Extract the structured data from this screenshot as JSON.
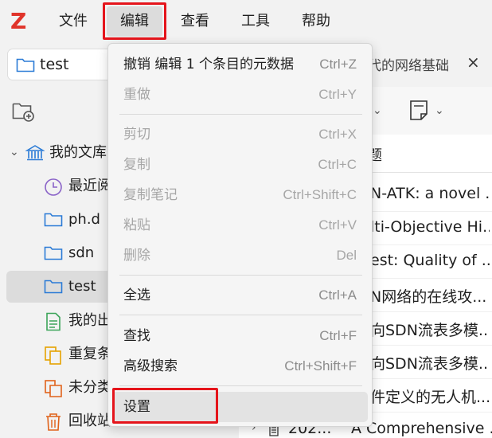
{
  "menubar": {
    "logo": "Z",
    "items": [
      "文件",
      "编辑",
      "查看",
      "工具",
      "帮助"
    ]
  },
  "location_tab": {
    "label": "test"
  },
  "right_tab": {
    "label": "代的网络基础",
    "close": "×"
  },
  "sidebar": {
    "items": [
      {
        "label": "我的文库",
        "icon": "library-icon"
      },
      {
        "label": "最近阅",
        "icon": "clock-icon"
      },
      {
        "label": "ph.d",
        "icon": "folder-icon"
      },
      {
        "label": "sdn",
        "icon": "folder-icon"
      },
      {
        "label": "test",
        "icon": "folder-icon"
      },
      {
        "label": "我的出",
        "icon": "document-icon"
      },
      {
        "label": "重复条",
        "icon": "duplicate-icon"
      },
      {
        "label": "未分类",
        "icon": "unfiled-icon"
      },
      {
        "label": "回收站",
        "icon": "trash-icon"
      }
    ]
  },
  "content": {
    "header": "题",
    "rows": [
      "N-ATK: a novel ...",
      "lti-Objective Hi...",
      "est: Quality of ...",
      "N网络的在线攻...",
      "向SDN流表多模...",
      "向SDN流表多模...",
      "件定义的无人机..."
    ],
    "bottom_row": {
      "year": "202...",
      "title": "A Comprehensive ..."
    }
  },
  "edit_menu": {
    "items": [
      {
        "label": "撤销 编辑 1 个条目的元数据",
        "shortcut": "Ctrl+Z",
        "enabled": true
      },
      {
        "label": "重做",
        "shortcut": "Ctrl+Y",
        "enabled": false
      },
      {
        "label": "剪切",
        "shortcut": "Ctrl+X",
        "enabled": false
      },
      {
        "label": "复制",
        "shortcut": "Ctrl+C",
        "enabled": false
      },
      {
        "label": "复制笔记",
        "shortcut": "Ctrl+Shift+C",
        "enabled": false
      },
      {
        "label": "粘贴",
        "shortcut": "Ctrl+V",
        "enabled": false
      },
      {
        "label": "删除",
        "shortcut": "Del",
        "enabled": false
      },
      {
        "label": "全选",
        "shortcut": "Ctrl+A",
        "enabled": true
      },
      {
        "label": "查找",
        "shortcut": "Ctrl+F",
        "enabled": true
      },
      {
        "label": "高级搜索",
        "shortcut": "Ctrl+Shift+F",
        "enabled": true
      },
      {
        "label": "设置",
        "shortcut": "",
        "enabled": true
      }
    ]
  },
  "colors": {
    "accent_red": "#e5141b",
    "logo_red": "#e0342a",
    "folder_blue": "#2b7bd6"
  }
}
